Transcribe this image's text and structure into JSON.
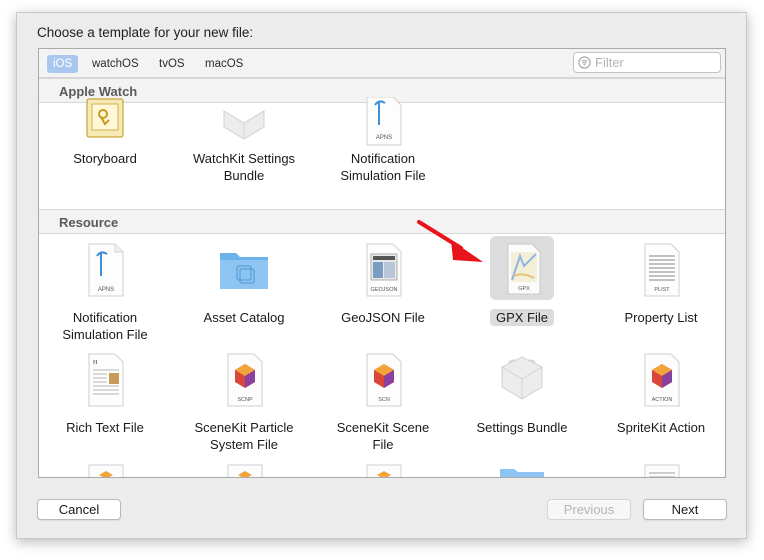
{
  "window": {
    "prompt": "Choose a template for your new file:"
  },
  "platforms": [
    {
      "label": "iOS",
      "active": true
    },
    {
      "label": "watchOS",
      "active": false
    },
    {
      "label": "tvOS",
      "active": false
    },
    {
      "label": "macOS",
      "active": false
    }
  ],
  "filter": {
    "placeholder": "Filter",
    "value": ""
  },
  "sections": [
    {
      "title": "Apple Watch",
      "items": [
        {
          "label1": "Storyboard",
          "label2": "",
          "icon": "storyboard-icon"
        },
        {
          "label1": "WatchKit Settings",
          "label2": "Bundle",
          "icon": "lego-brick-icon"
        },
        {
          "label1": "Notification",
          "label2": "Simulation File",
          "icon": "apns-file-icon",
          "badge": "APNS"
        }
      ]
    },
    {
      "title": "Resource",
      "items": [
        {
          "label1": "Notification",
          "label2": "Simulation File",
          "icon": "apns-file-icon",
          "badge": "APNS"
        },
        {
          "label1": "Asset Catalog",
          "label2": "",
          "icon": "folder-icon"
        },
        {
          "label1": "GeoJSON File",
          "label2": "",
          "icon": "geojson-file-icon",
          "badge": "GEOJSON"
        },
        {
          "label1": "GPX File",
          "label2": "",
          "icon": "gpx-file-icon",
          "badge": "GPX",
          "selected": true
        },
        {
          "label1": "Property List",
          "label2": "",
          "icon": "plist-file-icon",
          "badge": "PLIST"
        },
        {
          "label1": "Rich Text File",
          "label2": "",
          "icon": "rich-text-file-icon"
        },
        {
          "label1": "SceneKit Particle",
          "label2": "System File",
          "icon": "scnp-file-icon",
          "badge": "SCNP"
        },
        {
          "label1": "SceneKit Scene",
          "label2": "File",
          "icon": "scn-file-icon",
          "badge": "SCN"
        },
        {
          "label1": "Settings Bundle",
          "label2": "",
          "icon": "lego-brick-icon"
        },
        {
          "label1": "SpriteKit Action",
          "label2": "",
          "icon": "action-file-icon",
          "badge": "ACTION"
        }
      ]
    }
  ],
  "buttons": {
    "cancel": "Cancel",
    "previous": "Previous",
    "next": "Next"
  },
  "colors": {
    "accent_selected_tab": "#aac7ef",
    "arrow": "#e8141c",
    "selection": "#dcdcdc"
  }
}
